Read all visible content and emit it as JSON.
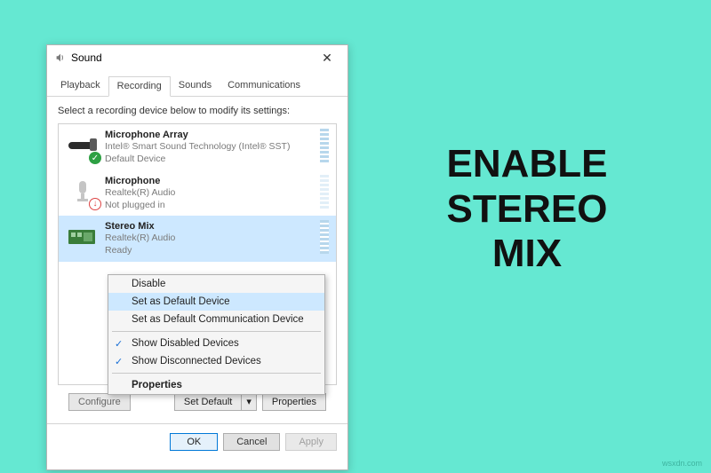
{
  "dialog": {
    "title": "Sound",
    "tabs": {
      "playback": "Playback",
      "recording": "Recording",
      "sounds": "Sounds",
      "communications": "Communications"
    },
    "instruction": "Select a recording device below to modify its settings:",
    "devices": [
      {
        "name": "Microphone Array",
        "desc": "Intel® Smart Sound Technology (Intel® SST)",
        "status": "Default Device"
      },
      {
        "name": "Microphone",
        "desc": "Realtek(R) Audio",
        "status": "Not plugged in"
      },
      {
        "name": "Stereo Mix",
        "desc": "Realtek(R) Audio",
        "status": "Ready"
      }
    ],
    "context_menu": {
      "disable": "Disable",
      "set_default": "Set as Default Device",
      "set_default_comm": "Set as Default Communication Device",
      "show_disabled": "Show Disabled Devices",
      "show_disconnected": "Show Disconnected Devices",
      "properties": "Properties"
    },
    "buttons": {
      "configure": "Configure",
      "set_default": "Set Default",
      "properties": "Properties",
      "ok": "OK",
      "cancel": "Cancel",
      "apply": "Apply"
    }
  },
  "side_heading": {
    "line1": "ENABLE",
    "line2": "STEREO",
    "line3": "MIX"
  },
  "watermark": "wsxdn.com"
}
